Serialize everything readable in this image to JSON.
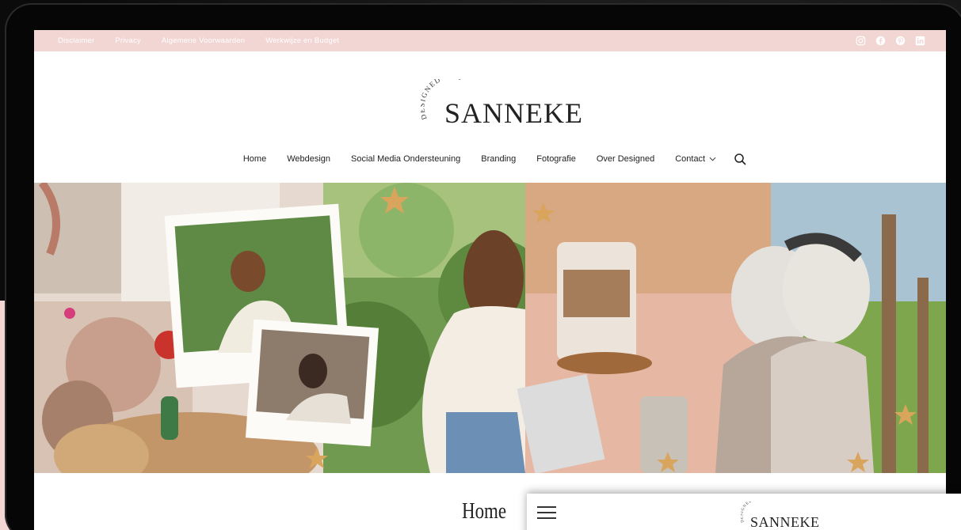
{
  "topbar": {
    "links": [
      "Disclaimer",
      "Privacy",
      "Algemene Voorwaarden",
      "Werkwijze en Budget"
    ],
    "socials": [
      "instagram-icon",
      "facebook-icon",
      "pinterest-icon",
      "linkedin-icon"
    ]
  },
  "logo": {
    "script_text": "DESIGNED • BY",
    "name": "SANNEKE"
  },
  "nav": {
    "items": [
      "Home",
      "Webdesign",
      "Social Media Ondersteuning",
      "Branding",
      "Fotografie",
      "Over Designed",
      "Contact"
    ]
  },
  "page": {
    "title": "Home"
  },
  "mobile_preview": {
    "logo_script": "DESIGNED • BY",
    "logo_name": "SANNEKE"
  },
  "colors": {
    "topbar": "#f1d6d3",
    "accent": "#e9c7c3"
  }
}
